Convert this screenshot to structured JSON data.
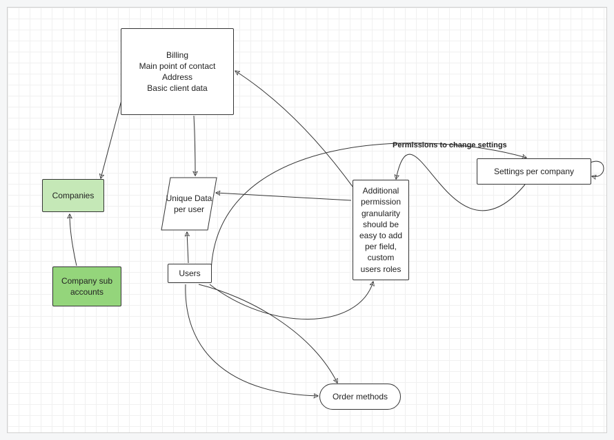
{
  "nodes": {
    "billing": "Billing\nMain point of contact\nAddress\nBasic client data",
    "companies": "Companies",
    "sub_accounts": "Company sub accounts",
    "unique_data": "Unique Data per user",
    "users": "Users",
    "additional_permission": "Additional permission granularity should be easy to add per field, custom users roles",
    "settings": "Settings per company",
    "order_methods": "Order methods"
  },
  "edges": {
    "permissions_label": "Permissions to change settings"
  },
  "colors": {
    "green_light": "#c5e8b7",
    "green_dark": "#94d57b"
  }
}
